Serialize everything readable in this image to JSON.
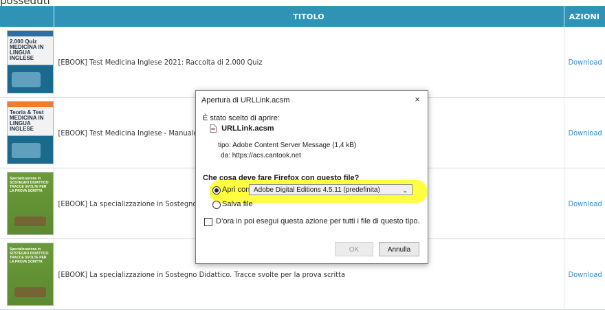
{
  "page": {
    "top_text": "posseduti"
  },
  "table": {
    "columns": [
      "",
      "TITOLO",
      "AZIONI"
    ],
    "rows": [
      {
        "cover_caption": "2.000 Quiz MEDICINA IN LINGUA INGLESE",
        "title": "[EBOOK] Test Medicina Inglese 2021: Raccolta di 2.000 Quiz",
        "action": "Download"
      },
      {
        "cover_caption": "Teoria & Test MEDICINA IN LINGUA INGLESE",
        "title": "[EBOOK] Test Medicina Inglese - Manuale",
        "action": "Download"
      },
      {
        "cover_caption": "Specializzazione in SOSTEGNO DIDATTICO TRACCE SVOLTE PER LA PROVA SCRITTA",
        "title": "[EBOOK] La specializzazione in Sostegno",
        "action": "Download"
      },
      {
        "cover_caption": "Specializzazione in SOSTEGNO DIDATTICO TRACCE SVOLTE PER LA PROVA SCRITTA",
        "title": "[EBOOK] La specializzazione in Sostegno Didattico. Tracce svolte per la prova scritta",
        "action": "Download"
      }
    ]
  },
  "dialog": {
    "title": "Apertura di URLLink.acsm",
    "close_icon": "×",
    "chosen_label": "È stato scelto di aprire:",
    "file_name": "URLLink.acsm",
    "type_label": "tipo:",
    "type_value": "Adobe Content Server Message (1,4 kB)",
    "from_label": "da:",
    "from_value": "https://acs.cantook.net",
    "question": "Che cosa deve fare Firefox con questo file?",
    "open_with_label": "Apri con",
    "open_with_value": "Adobe Digital Editions 4.5.11 (predefinita)",
    "save_file_label": "Salva file",
    "remember_label": "D’ora in poi esegui questa azione per tutti i file di questo tipo.",
    "ok_label": "OK",
    "cancel_label": "Annulla"
  },
  "colors": {
    "header_bg": "#2f93b6",
    "link": "#2f8ed0",
    "highlight": "#ffff2a"
  }
}
